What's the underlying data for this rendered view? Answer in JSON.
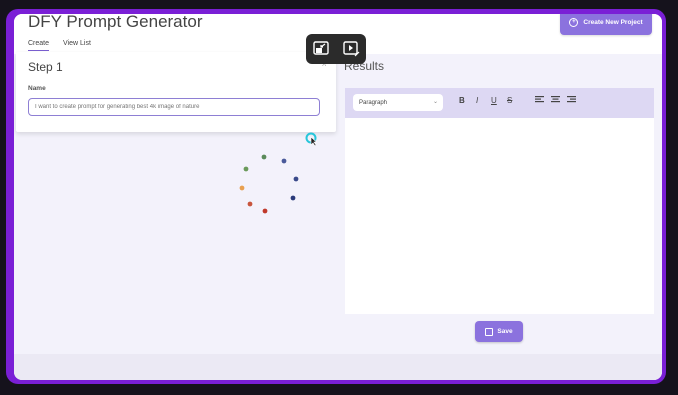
{
  "app": {
    "title": "DFY Prompt Generator",
    "tabs": [
      "Create",
      "View List"
    ],
    "create_button_label": "Create New Project"
  },
  "step": {
    "title": "Step 1",
    "name_label": "Name",
    "name_placeholder": "I want to create prompt for generating best 4k image of nature"
  },
  "results": {
    "title": "Results",
    "format_select": "Paragraph",
    "toolbar": [
      "B",
      "I",
      "U",
      "S"
    ]
  },
  "save_label": "Save",
  "colors": {
    "accent": "#8b72de",
    "frame": "#7a1fd6",
    "background": "#f3f2fb",
    "toolbar_bg": "#ddd8f3"
  },
  "icons": [
    "plus-circle-icon",
    "chevron-up-icon",
    "exit-fullscreen-icon",
    "play-magic-icon",
    "save-icon",
    "loading-spinner-icon",
    "cursor-icon"
  ]
}
